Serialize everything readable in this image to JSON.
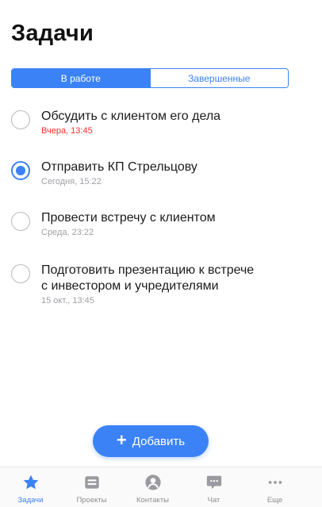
{
  "header": {
    "title": "Задачи"
  },
  "segments": [
    {
      "label": "В работе",
      "active": true
    },
    {
      "label": "Завершенные",
      "active": false
    }
  ],
  "tasks": [
    {
      "title": "Обсудить с клиентом его дела",
      "time": "Вчера, 13:45",
      "done": false,
      "overdue": true
    },
    {
      "title": "Отправить КП Стрельцову",
      "time": "Сегодня, 15:22",
      "done": true,
      "overdue": false
    },
    {
      "title": "Провести встречу с клиентом",
      "time": "Среда, 23:22",
      "done": false,
      "overdue": false
    },
    {
      "title_lines": [
        "Подготовить презентацию к встрече",
        "с инвестором и учредителями"
      ],
      "time": "15 окт., 13:45",
      "done": false,
      "overdue": false
    }
  ],
  "fab": {
    "label": "Добавить",
    "icon": "plus-icon"
  },
  "tabbar": {
    "items": [
      {
        "label": "Задачи",
        "icon": "star-icon",
        "active": true
      },
      {
        "label": "Проекты",
        "icon": "projects-icon",
        "active": false
      },
      {
        "label": "Контакты",
        "icon": "contact-icon",
        "active": false
      },
      {
        "label": "Чат",
        "icon": "chat-icon",
        "active": false
      },
      {
        "label": "Еще",
        "icon": "more-icon",
        "active": false
      }
    ]
  },
  "colors": {
    "accent": "#3b82f6",
    "overdue": "#ff2d2d",
    "muted": "#a0a0a6",
    "icon_gray": "#9a9aa0"
  }
}
